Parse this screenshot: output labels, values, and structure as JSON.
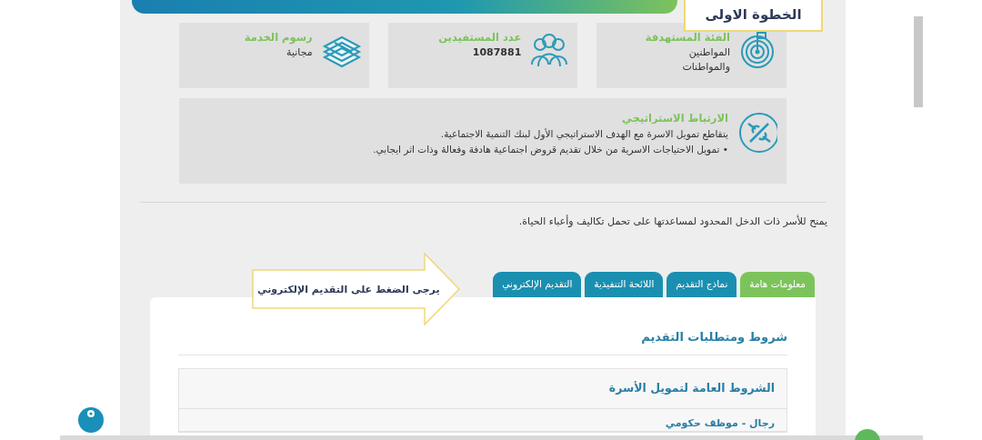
{
  "step_callout": {
    "text": "الخطوة الاولى"
  },
  "info_cards": [
    {
      "kind": "target",
      "title": "الفئة المستهدفة",
      "lines": [
        "المواطنين",
        "والمواطنات"
      ]
    },
    {
      "kind": "people",
      "title": "عدد المستفيدين",
      "lines": [
        "1087881"
      ]
    },
    {
      "kind": "money",
      "title": "رسوم الخدمة",
      "lines": [
        "مجانية"
      ]
    }
  ],
  "strategic": {
    "title": "الارتباط الاستراتيجي",
    "lines": [
      "يتقاطع تمويل الاسرة مع الهدف الاستراتيجي الأول لبنك التنمية الاجتماعية.",
      "• تمويل الاحتياجات الاسرية من خلال تقديم قروض اجتماعية هادفة وفعالة وذات اثر ايجابي."
    ]
  },
  "description": "يمنح للأسر ذات الدخل المحدود لمساعدتها على تحمل تكاليف وأعباء الحياة.",
  "tabs": [
    {
      "label": "معلومات هامة",
      "selected": true
    },
    {
      "label": "نماذج التقديم",
      "selected": false
    },
    {
      "label": "اللائحة التنفيذية",
      "selected": false
    },
    {
      "label": "التقديم الإلكتروني",
      "selected": false
    }
  ],
  "hint_callout": {
    "text": "يرجى الضغط على التقديم الإلكتروني"
  },
  "panel": {
    "heading": "شروط ومتطلبات التقديم",
    "accordion": [
      {
        "title": "الشروط العامة لتمويل الأسرة"
      },
      {
        "title": "رجال - موظف حكومي"
      }
    ]
  }
}
